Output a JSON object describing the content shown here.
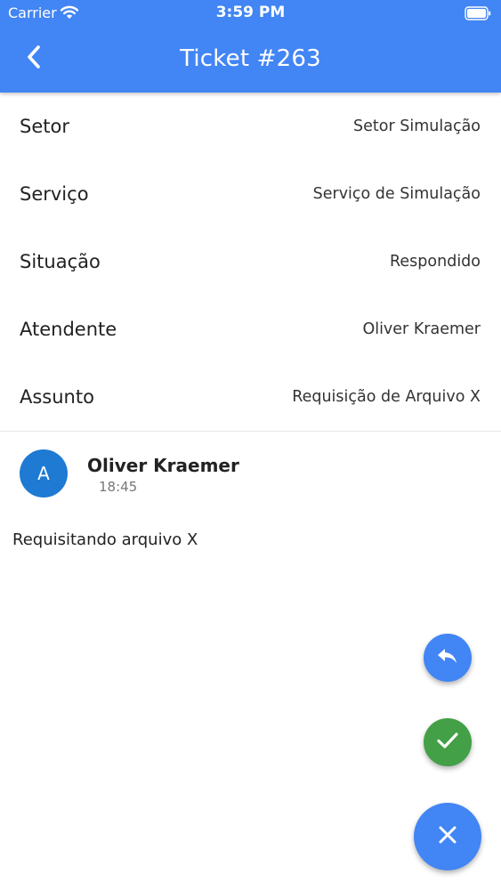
{
  "status_bar": {
    "carrier": "Carrier",
    "time": "3:59 PM",
    "wifi_icon": "wifi-icon",
    "battery_icon": "battery-icon"
  },
  "app_bar": {
    "title": "Ticket #263",
    "back_icon": "chevron-left-icon",
    "background_color": "#4285f4"
  },
  "details": [
    {
      "label": "Setor",
      "value": "Setor Simulação"
    },
    {
      "label": "Serviço",
      "value": "Serviço de Simulação"
    },
    {
      "label": "Situação",
      "value": "Respondido"
    },
    {
      "label": "Atendente",
      "value": "Oliver Kraemer"
    },
    {
      "label": "Assunto",
      "value": "Requisição de Arquivo X"
    }
  ],
  "message": {
    "avatar_letter": "A",
    "author": "Oliver Kraemer",
    "time": "18:45",
    "text": "Requisitando arquivo X",
    "avatar_color": "#1e7ad2"
  },
  "actions": {
    "reply": {
      "icon": "reply-icon",
      "color": "#4285f4"
    },
    "resolve": {
      "icon": "check-icon",
      "color": "#43a047"
    },
    "close": {
      "icon": "close-icon",
      "color": "#4285f4"
    }
  }
}
